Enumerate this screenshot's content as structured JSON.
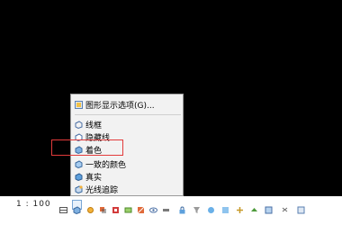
{
  "menu": {
    "graphic_display_options": "图形显示选项(G)...",
    "items": [
      "线框",
      "隐藏线",
      "着色",
      "一致的颜色",
      "真实",
      "光线追踪"
    ],
    "highlighted": "着色"
  },
  "statusbar": {
    "scale": "1 : 100",
    "icons": [
      "detail-level-icon",
      "visual-style-icon",
      "sun-path-icon",
      "shadows-icon",
      "crop-view-icon",
      "show-crop-icon",
      "temporary-hide-icon",
      "reveal-hidden-icon",
      "constraints-icon",
      "lock-icon",
      "filter-icon",
      "analysis-icon",
      "highlight-icon",
      "worksharing-icon",
      "design-options-icon",
      "pin-icon",
      "select-links-icon",
      "select-underlay-icon"
    ]
  },
  "colors": {
    "highlight_border": "#e23b3b",
    "menu_bg": "#f2f2f2",
    "canvas_bg": "#000000"
  }
}
